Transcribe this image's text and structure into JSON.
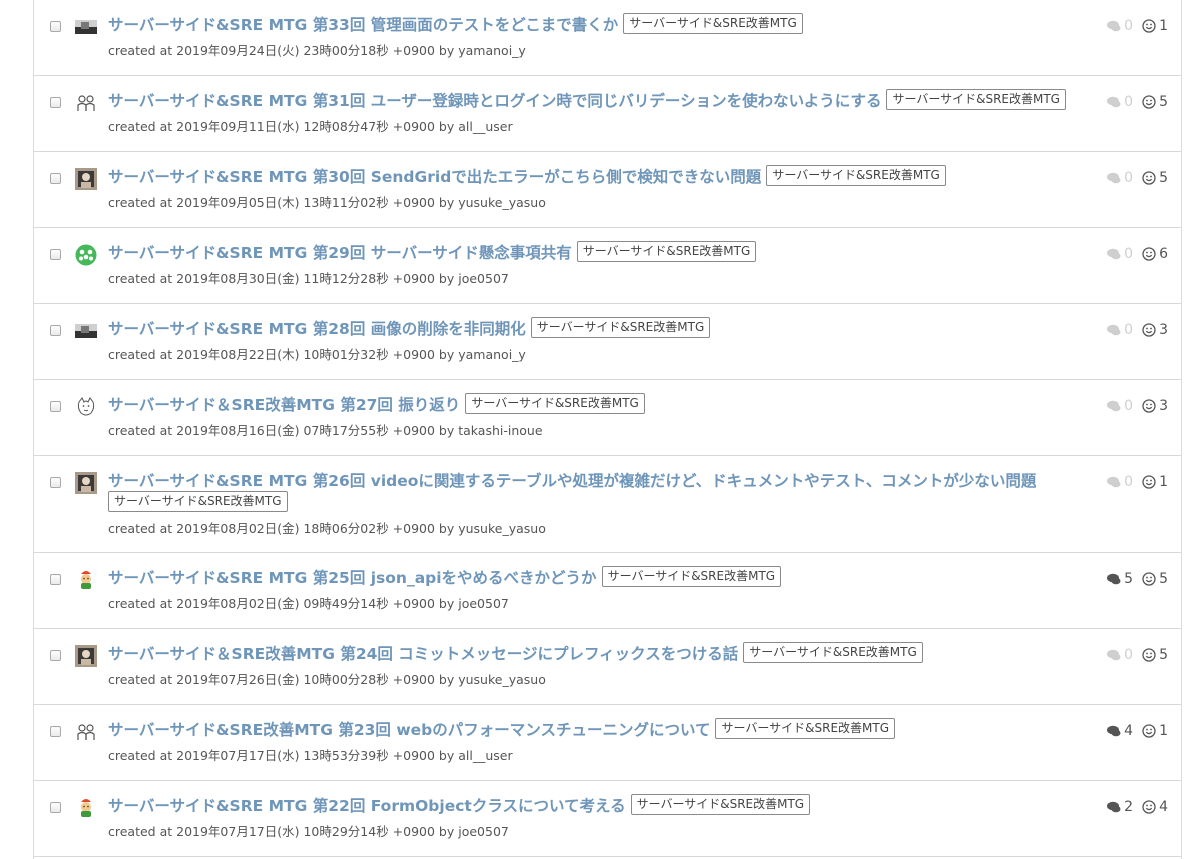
{
  "tag_label": "サーバーサイド&SRE改善MTG",
  "items": [
    {
      "title": "サーバーサイド&SRE MTG 第33回 管理画面のテストをどこまで書くか",
      "created": "created at 2019年09月24日(火) 23時00分18秒 +0900 by yamanoi_y",
      "comments": "0",
      "stars": "1",
      "avatar": "photo-avatar-icon"
    },
    {
      "title": "サーバーサイド&SRE MTG 第31回 ユーザー登録時とログイン時で同じバリデーションを使わないようにする",
      "created": "created at 2019年09月11日(水) 12時08分47秒 +0900 by all__user",
      "comments": "0",
      "stars": "5",
      "avatar": "group-avatar-icon"
    },
    {
      "title": "サーバーサイド&SRE MTG 第30回 SendGridで出たエラーがこちら側で検知できない問題",
      "created": "created at 2019年09月05日(木) 13時11分02秒 +0900 by yusuke_yasuo",
      "comments": "0",
      "stars": "5",
      "avatar": "photo-avatar-icon"
    },
    {
      "title": "サーバーサイド&SRE MTG 第29回 サーバーサイド懸念事項共有",
      "created": "created at 2019年08月30日(金) 11時12分28秒 +0900 by joe0507",
      "comments": "0",
      "stars": "6",
      "avatar": "green-avatar-icon"
    },
    {
      "title": "サーバーサイド&SRE MTG 第28回 画像の削除を非同期化",
      "created": "created at 2019年08月22日(木) 10時01分32秒 +0900 by yamanoi_y",
      "comments": "0",
      "stars": "3",
      "avatar": "photo-avatar-icon"
    },
    {
      "title": "サーバーサイド＆SRE改善MTG 第27回 振り返り",
      "created": "created at 2019年08月16日(金) 07時17分55秒 +0900 by takashi-inoue",
      "comments": "0",
      "stars": "3",
      "avatar": "sketch-avatar-icon"
    },
    {
      "title": "サーバーサイド&SRE MTG 第26回 videoに関連するテーブルや処理が複雑だけど、ドキュメントやテスト、コメントが少ない問題",
      "created": "created at 2019年08月02日(金) 18時06分02秒 +0900 by yusuke_yasuo",
      "comments": "0",
      "stars": "1",
      "avatar": "photo-avatar-icon"
    },
    {
      "title": "サーバーサイド&SRE MTG 第25回 json_apiをやめるべきかどうか",
      "created": "created at 2019年08月02日(金) 09時49分14秒 +0900 by joe0507",
      "comments": "5",
      "stars": "5",
      "avatar": "mascot-avatar-icon"
    },
    {
      "title": "サーバーサイド＆SRE改善MTG 第24回 コミットメッセージにプレフィックスをつける話",
      "created": "created at 2019年07月26日(金) 10時00分28秒 +0900 by yusuke_yasuo",
      "comments": "0",
      "stars": "5",
      "avatar": "photo-avatar-icon"
    },
    {
      "title": "サーバーサイド&SRE改善MTG 第23回 webのパフォーマンスチューニングについて",
      "created": "created at 2019年07月17日(水) 13時53分39秒 +0900 by all__user",
      "comments": "4",
      "stars": "1",
      "avatar": "group-avatar-icon"
    },
    {
      "title": "サーバーサイド&SRE MTG 第22回 FormObjectクラスについて考える",
      "created": "created at 2019年07月17日(水) 10時29分14秒 +0900 by joe0507",
      "comments": "2",
      "stars": "4",
      "avatar": "mascot-avatar-icon"
    }
  ]
}
